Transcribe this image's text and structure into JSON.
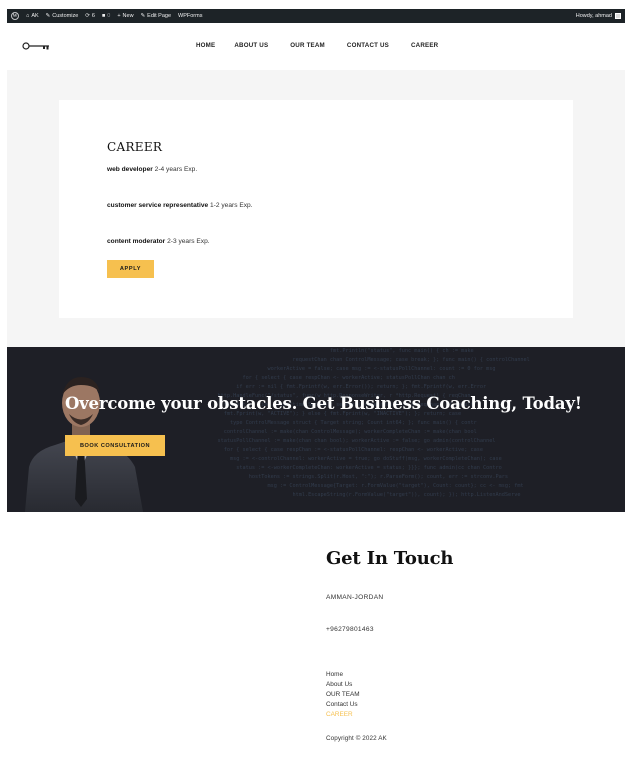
{
  "admin_bar": {
    "site_name": "AK",
    "customize": "Customize",
    "updates_count": "6",
    "comments_count": "0",
    "new": "New",
    "edit_page": "Edit Page",
    "wpforms": "WPForms",
    "howdy": "Howdy, ahmad"
  },
  "nav": {
    "items": [
      "HOME",
      "ABOUT US",
      "OUR TEAM",
      "CONTACT US",
      "CAREER"
    ]
  },
  "career": {
    "title": "CAREER",
    "jobs": [
      {
        "role": "web developer",
        "exp": "2-4 years Exp."
      },
      {
        "role": "customer service representative",
        "exp": "1-2 years Exp."
      },
      {
        "role": "content moderator",
        "exp": "2-3 years Exp."
      }
    ],
    "apply_label": "APPLY"
  },
  "hero": {
    "heading": "Overcome your obstacles. Get Business Coaching, Today!",
    "button_label": "BOOK CONSULTATION"
  },
  "footer": {
    "title": "Get In Touch",
    "address": "AMMAN-JORDAN",
    "phone": "+96279801463",
    "links": [
      "Home",
      "About Us",
      "OUR TEAM",
      "Contact Us",
      "CAREER"
    ],
    "copyright": "Copyright © 2022 AK"
  },
  "colors": {
    "accent": "#f6c04f",
    "admin_bar": "#1d2327",
    "hero_bg": "#1e1f26"
  }
}
